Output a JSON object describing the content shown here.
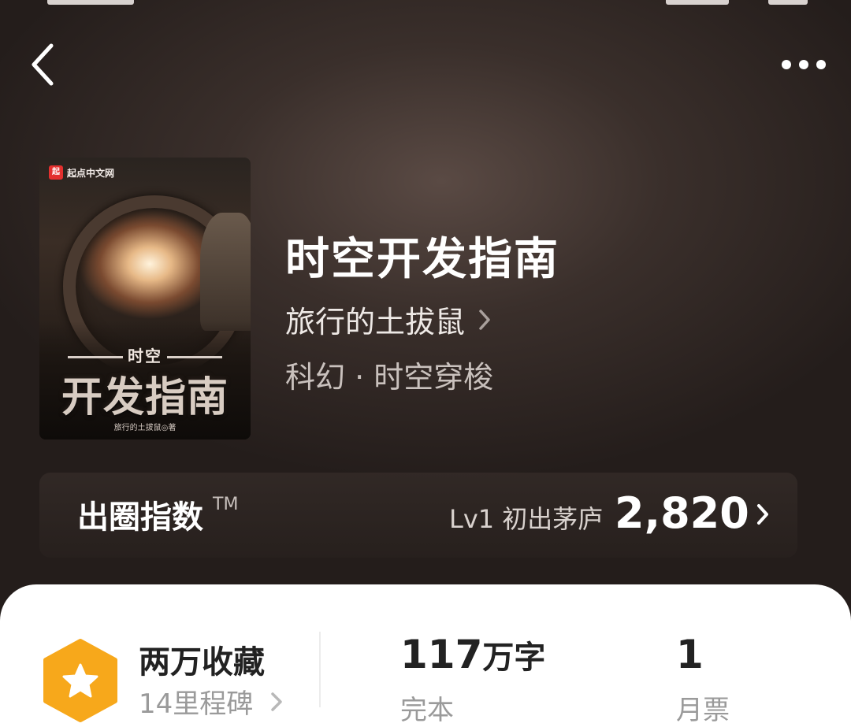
{
  "header": {
    "back_icon": "chevron-left-icon",
    "more_icon": "more-horizontal-icon"
  },
  "cover": {
    "publisher": "起点中文网",
    "publisher_logo": "起",
    "small_title": "时空",
    "big_title": "开发指南",
    "author_credit": "旅行的土拔鼠◎著"
  },
  "book": {
    "title": "时空开发指南",
    "author": "旅行的土拔鼠",
    "genre": "科幻 · 时空穿梭"
  },
  "index": {
    "label": "出圈指数",
    "trademark": "TM",
    "level": "Lv1 初出茅庐",
    "value": "2,820"
  },
  "stats": {
    "collection_title": "两万收藏",
    "milestone": "14里程碑",
    "word_count_number": "117",
    "word_count_unit": "万字",
    "status": "完本",
    "tickets_number": "1",
    "tickets_label": "月票"
  },
  "colors": {
    "background": "#2a2220",
    "sheet": "#ffffff",
    "badge": "#f7a81b",
    "text_primary": "#ffffff",
    "text_dark": "#222222",
    "text_muted": "#9a9a9a"
  }
}
